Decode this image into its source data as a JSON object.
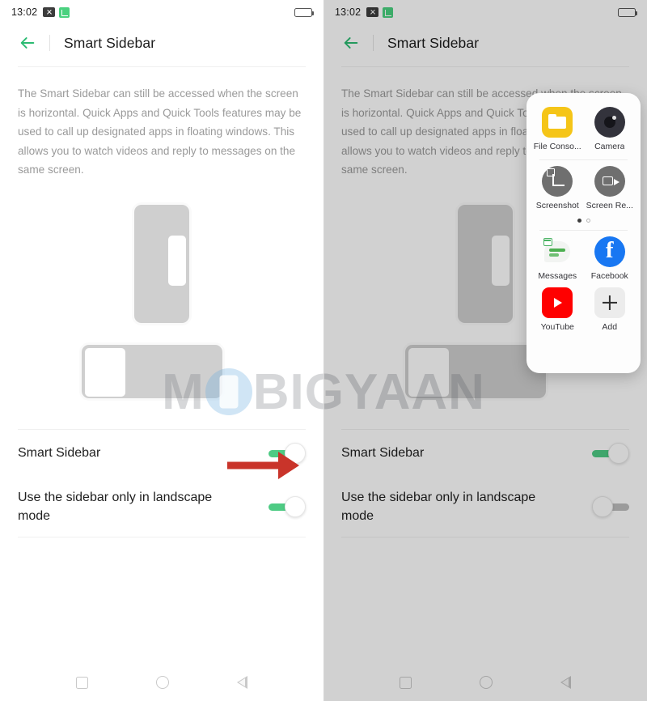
{
  "statusbar": {
    "time": "13:02",
    "icons": [
      "no-sim-icon",
      "signal-icon"
    ],
    "battery_icon": "battery-low-icon"
  },
  "appbar": {
    "back_icon": "back-arrow-icon",
    "title": "Smart Sidebar"
  },
  "description": "The Smart Sidebar can still be accessed when the screen is horizontal. Quick Apps and Quick Tools features may be used to call up designated apps in floating windows. This allows you to watch videos and reply to messages on the same screen.",
  "illustration": {
    "portrait_phone": "phone-portrait-illustration",
    "landscape_phone": "phone-landscape-illustration"
  },
  "settings": {
    "rows": [
      {
        "label": "Smart Sidebar",
        "state_left": "on",
        "state_right": "on"
      },
      {
        "label": "Use the sidebar only in landscape mode",
        "state_left": "on",
        "state_right": "off"
      }
    ]
  },
  "navbar": {
    "recents": "recents-square-icon",
    "home": "home-circle-icon",
    "back": "back-triangle-icon"
  },
  "app_drawer": {
    "apps": [
      {
        "label": "File Conso...",
        "icon": "file-console-icon"
      },
      {
        "label": "Camera",
        "icon": "camera-icon"
      },
      {
        "label": "Screenshot",
        "icon": "screenshot-icon"
      },
      {
        "label": "Screen Re...",
        "icon": "screen-record-icon"
      },
      {
        "label": "Messages",
        "icon": "messages-icon"
      },
      {
        "label": "Facebook",
        "icon": "facebook-icon"
      },
      {
        "label": "YouTube",
        "icon": "youtube-icon"
      },
      {
        "label": "Add",
        "icon": "add-plus-icon"
      }
    ],
    "page_dots": {
      "total": 2,
      "active": 1
    }
  },
  "annotations": {
    "arrow_left": "red-arrow-pointing-to-smart-sidebar-toggle",
    "arrow_right": "red-arrow-pointing-to-app-drawer"
  },
  "watermark": {
    "text_before": "M",
    "logo": "mobigyaan-phone-logo",
    "text_after": "BIGYAAN"
  },
  "colors": {
    "accent_green": "#4ecb84",
    "arrow_red": "#c9342a",
    "facebook_blue": "#1877f2",
    "youtube_red": "#ff0000",
    "files_yellow": "#f5c518"
  }
}
